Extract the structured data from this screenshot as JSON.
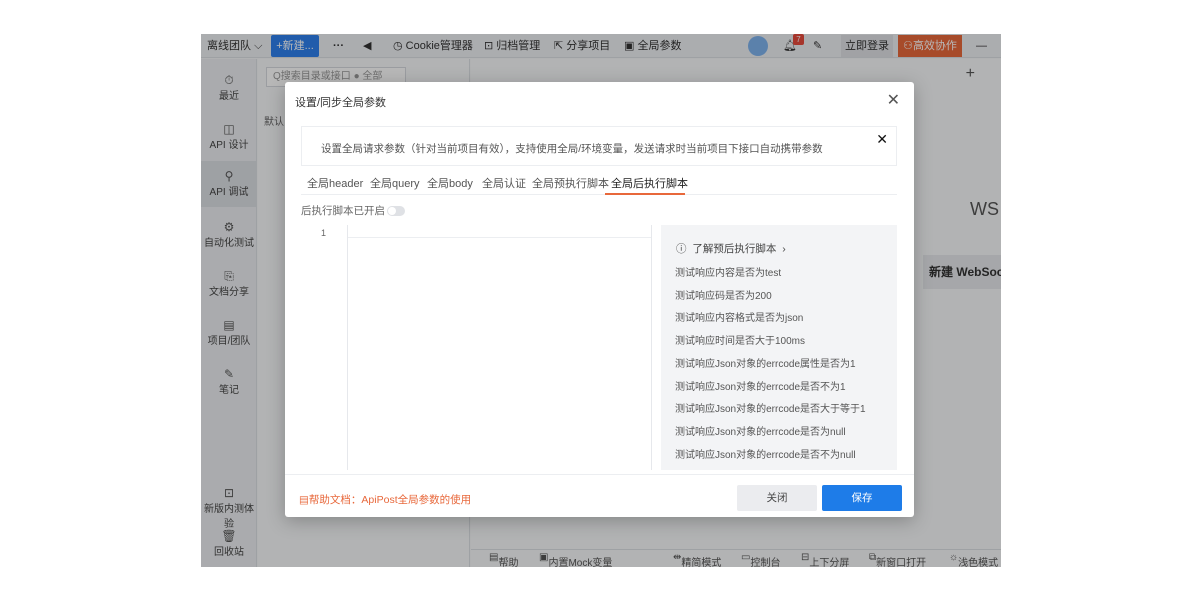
{
  "topbar": {
    "team": "离线团队",
    "team_caret": "⌵",
    "new_button": "+新建...",
    "more": "···",
    "back": "◀",
    "cookie": "Cookie管理器",
    "archive": "归档管理",
    "share": "分享项目",
    "global_params": "全局参数",
    "notification_count": "7",
    "login": "立即登录",
    "collab": "高效协作",
    "minimize": "—"
  },
  "sidebar": {
    "items": [
      {
        "icon": "clock-icon",
        "glyph": "⏱",
        "label": "最近"
      },
      {
        "icon": "api-design-icon",
        "glyph": "◫",
        "label": "API 设计"
      },
      {
        "icon": "api-debug-icon",
        "glyph": "⚲",
        "label": "API 调试"
      },
      {
        "icon": "automation-icon",
        "glyph": "⚙",
        "label": "自动化测试"
      },
      {
        "icon": "doc-share-icon",
        "glyph": "⎘",
        "label": "文档分享"
      },
      {
        "icon": "project-team-icon",
        "glyph": "▤",
        "label": "项目/团队"
      },
      {
        "icon": "notes-icon",
        "glyph": "✎",
        "label": "笔记"
      },
      {
        "icon": "beta-icon",
        "glyph": "⊡",
        "label": "新版内测体验"
      },
      {
        "icon": "trash-icon",
        "glyph": "🗑",
        "label": "回收站"
      }
    ]
  },
  "col2": {
    "search_placeholder": "Q搜索目录或接口",
    "filter": "● 全部",
    "default_label": "默认"
  },
  "main": {
    "ws_label": "WS",
    "new_websocket": "新建 WebSocket"
  },
  "bottombar": {
    "help": "帮助",
    "mock": "内置Mock变量",
    "simple": "精简模式",
    "console": "控制台",
    "split": "上下分屏",
    "new_window": "新窗口打开",
    "light": "浅色模式"
  },
  "modal": {
    "title": "设置/同步全局参数",
    "notice": "设置全局请求参数（针对当前项目有效），支持使用全局/环境变量，发送请求时当前项目下接口自动携带参数",
    "tabs": [
      {
        "label": "全局header",
        "active": false
      },
      {
        "label": "全局query",
        "active": false
      },
      {
        "label": "全局body",
        "active": false
      },
      {
        "label": "全局认证",
        "active": false
      },
      {
        "label": "全局预执行脚本",
        "active": false
      },
      {
        "label": "全局后执行脚本",
        "active": true
      }
    ],
    "toggle_label": "后执行脚本已开启",
    "toggle_on": false,
    "editor_line": "1",
    "snippets_head": "了解预后执行脚本",
    "snippets": [
      "测试响应内容是否为test",
      "测试响应码是否为200",
      "测试响应内容格式是否为json",
      "测试响应时间是否大于100ms",
      "测试响应Json对象的errcode属性是否为1",
      "测试响应Json对象的errcode是否不为1",
      "测试响应Json对象的errcode是否大于等于1",
      "测试响应Json对象的errcode是否为null",
      "测试响应Json对象的errcode是否不为null"
    ],
    "help_link": "帮助文档：ApiPost全局参数的使用",
    "close_button": "关闭",
    "save_button": "保存"
  },
  "colors": {
    "accent_blue": "#1e7ce8",
    "accent_orange": "#e8683b"
  }
}
